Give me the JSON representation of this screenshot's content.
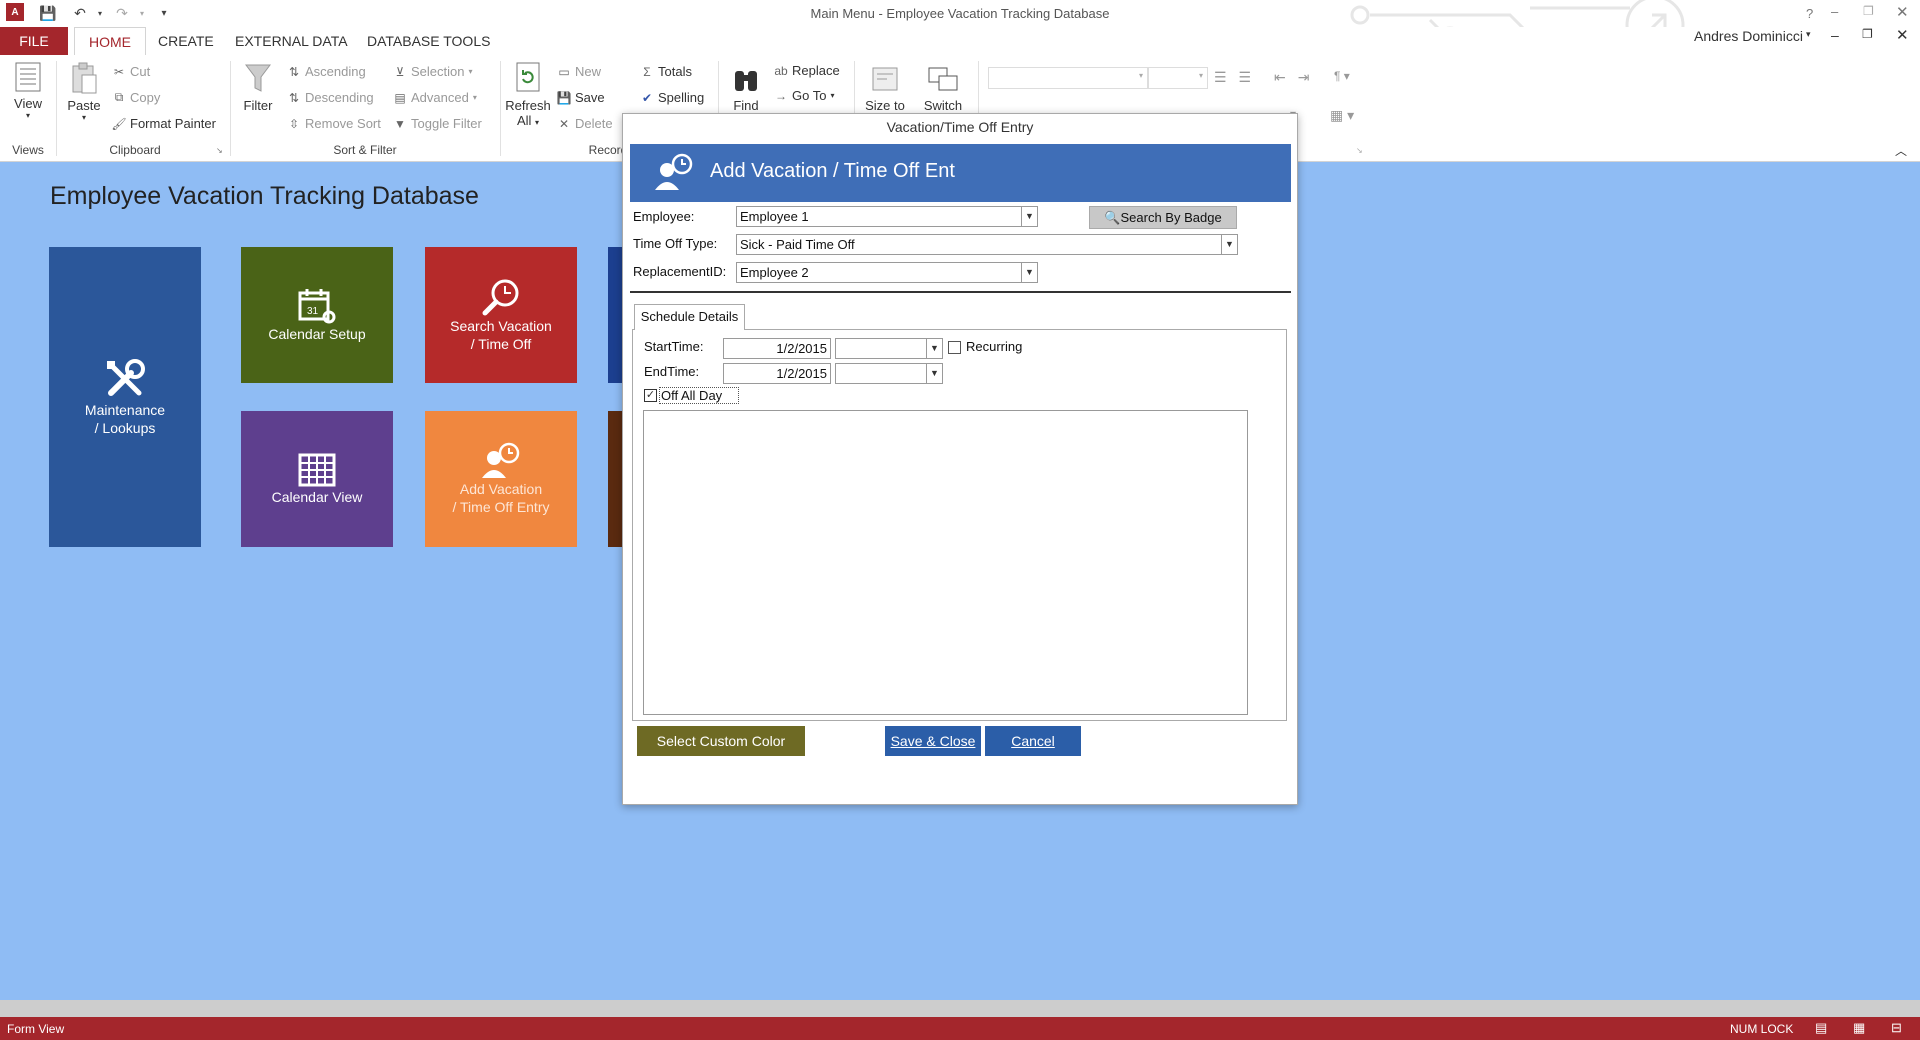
{
  "window": {
    "title": "Main Menu - Employee Vacation Tracking Database",
    "user": "Andres Dominicci",
    "help": "?"
  },
  "tabs": [
    "FILE",
    "HOME",
    "CREATE",
    "EXTERNAL DATA",
    "DATABASE TOOLS"
  ],
  "ribbon": {
    "views": {
      "view": "View",
      "label": "Views"
    },
    "clipboard": {
      "paste": "Paste",
      "cut": "Cut",
      "copy": "Copy",
      "format_painter": "Format Painter",
      "label": "Clipboard"
    },
    "sort_filter": {
      "filter": "Filter",
      "ascending": "Ascending",
      "descending": "Descending",
      "remove_sort": "Remove Sort",
      "selection": "Selection",
      "advanced": "Advanced",
      "toggle_filter": "Toggle Filter",
      "label": "Sort & Filter"
    },
    "records": {
      "refresh": "Refresh",
      "refresh_all": "All",
      "new": "New",
      "save": "Save",
      "delete": "Delete",
      "totals": "Totals",
      "spelling": "Spelling",
      "label": "Records"
    },
    "find": {
      "find": "Find",
      "replace": "Replace",
      "goto": "Go To"
    },
    "window_grp": {
      "size_to": "Size to",
      "switch": "Switch"
    }
  },
  "main": {
    "title": "Employee Vacation Tracking Database",
    "tiles": [
      {
        "label1": "Maintenance",
        "label2": "/ Lookups",
        "color": "#2b579a"
      },
      {
        "label1": "Calendar Setup",
        "label2": "",
        "color": "#4a6317"
      },
      {
        "label1": "Search Vacation",
        "label2": "/ Time Off",
        "color": "#b52a2a"
      },
      {
        "label1": "Calendar View",
        "label2": "",
        "color": "#5e3f8e"
      },
      {
        "label1": "Add Vacation",
        "label2": "/ Time Off Entry",
        "color": "#f0873f"
      }
    ]
  },
  "dialog": {
    "title": "Vacation/Time Off Entry",
    "header": "Add Vacation / Time Off Ent",
    "employee_label": "Employee:",
    "employee_value": "Employee 1",
    "search_badge": "Search By Badge",
    "timeoff_label": "Time Off Type:",
    "timeoff_value": "Sick - Paid Time Off",
    "replacement_label": "ReplacementID:",
    "replacement_value": "Employee 2",
    "tab_label": "Schedule Details",
    "start_label": "StartTime:",
    "start_value": "1/2/2015",
    "end_label": "EndTime:",
    "end_value": "1/2/2015",
    "recurring_label": "Recurring",
    "offallday_label": "Off All Day",
    "custom_color": "Select Custom Color",
    "save_close": "Save & Close",
    "cancel": "Cancel"
  },
  "status": {
    "left": "Form View",
    "numlock": "NUM LOCK"
  }
}
